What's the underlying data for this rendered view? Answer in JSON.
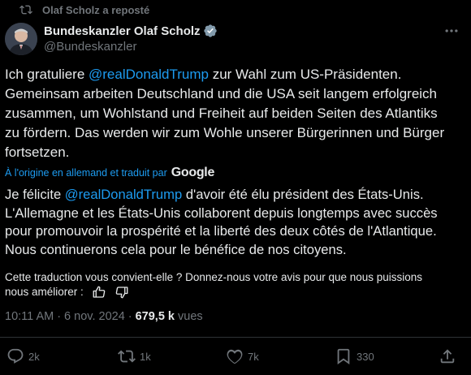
{
  "repost": {
    "label": "Olaf Scholz a reposté"
  },
  "author": {
    "name": "Bundeskanzler Olaf Scholz",
    "handle": "@Bundeskanzler"
  },
  "tweet": {
    "before": "Ich gratuliere ",
    "mention": "@realDonaldTrump",
    "after": " zur Wahl zum US-Präsidenten.\nGemeinsam arbeiten Deutschland und die USA seit langem erfolgreich\nzusammen, um Wohlstand und Freiheit auf beiden Seiten des Atlantiks\nzu fördern. Das werden wir zum Wohle unserer Bürgerinnen und Bürger\nfortsetzen."
  },
  "translation": {
    "origin": "À l'origine en allemand et traduit par",
    "provider": "Google",
    "before": "Je félicite ",
    "mention": "@realDonaldTrump",
    "after": " d'avoir été élu président des États-Unis.\nL'Allemagne et les États-Unis collaborent depuis longtemps avec succès\npour promouvoir la prospérité et la liberté des deux côtés de l'Atlantique.\nNous continuerons cela pour le bénéfice de nos citoyens."
  },
  "feedback": {
    "line1": "Cette traduction vous convient-elle ? Donnez-nous votre avis pour que nous puissions",
    "line2": "nous améliorer :"
  },
  "meta": {
    "time": "10:11 AM",
    "separator": "·",
    "date": "6 nov. 2024",
    "views_count": "679,5 k",
    "views_label": "vues"
  },
  "actions": {
    "replies": "2k",
    "reposts": "1k",
    "likes": "7k",
    "bookmarks": "330"
  },
  "colors": {
    "background": "#000000",
    "accent": "#1d9bf0",
    "text": "#e7e9ea",
    "muted": "#71767b",
    "verified": "#829aab"
  },
  "icons": [
    "repost-icon",
    "verified-badge-icon",
    "more-icon",
    "thumbs-up-icon",
    "thumbs-down-icon",
    "reply-icon",
    "bookmark-icon",
    "heart-icon",
    "share-icon"
  ]
}
